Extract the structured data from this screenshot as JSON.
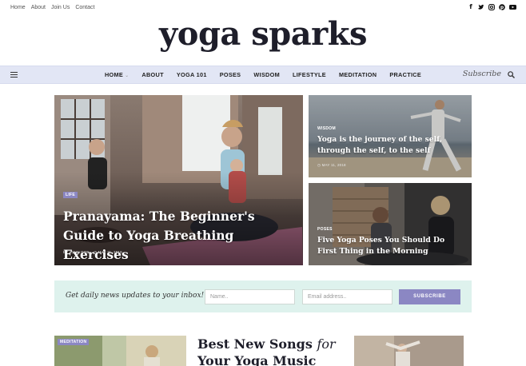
{
  "topbar": {
    "links": [
      "Home",
      "About",
      "Join Us",
      "Contact"
    ],
    "social_icons": [
      "facebook-icon",
      "twitter-icon",
      "instagram-icon",
      "pinterest-icon",
      "youtube-icon"
    ]
  },
  "logo": "yoga sparks",
  "nav": {
    "items": [
      "HOME",
      "ABOUT",
      "YOGA 101",
      "POSES",
      "WISDOM",
      "LIFESTYLE",
      "MEDITATION",
      "PRACTICE"
    ],
    "subscribe": "Subscribe"
  },
  "featured": {
    "main": {
      "category": "LIFE",
      "title": "Pranayama: The Beginner's Guide to Yoga Breathing Exercises",
      "author": "BY JOHN DOE",
      "date": "MAY 11, 2018"
    },
    "side_top": {
      "category": "WISDOM",
      "title": "Yoga is the journey of the self, through the self, to the self",
      "date": "MAY 11, 2018"
    },
    "side_bottom": {
      "category": "POSES",
      "title": "Five Yoga Poses You Should Do First Thing in the Morning"
    }
  },
  "newsletter": {
    "text": "Get daily news updates to your inbox!",
    "name_placeholder": "Name..",
    "email_placeholder": "Email address..",
    "button": "SUBSCRIBE"
  },
  "bottom": {
    "card_category": "MEDITATION",
    "section_title_bold": "Best New Songs",
    "section_title_italic": "for",
    "section_title_line2": "Your Yoga Music"
  },
  "colors": {
    "accent": "#8b87c3",
    "nav_bg": "#e2e6f5",
    "newsletter_bg": "#def2ed"
  }
}
